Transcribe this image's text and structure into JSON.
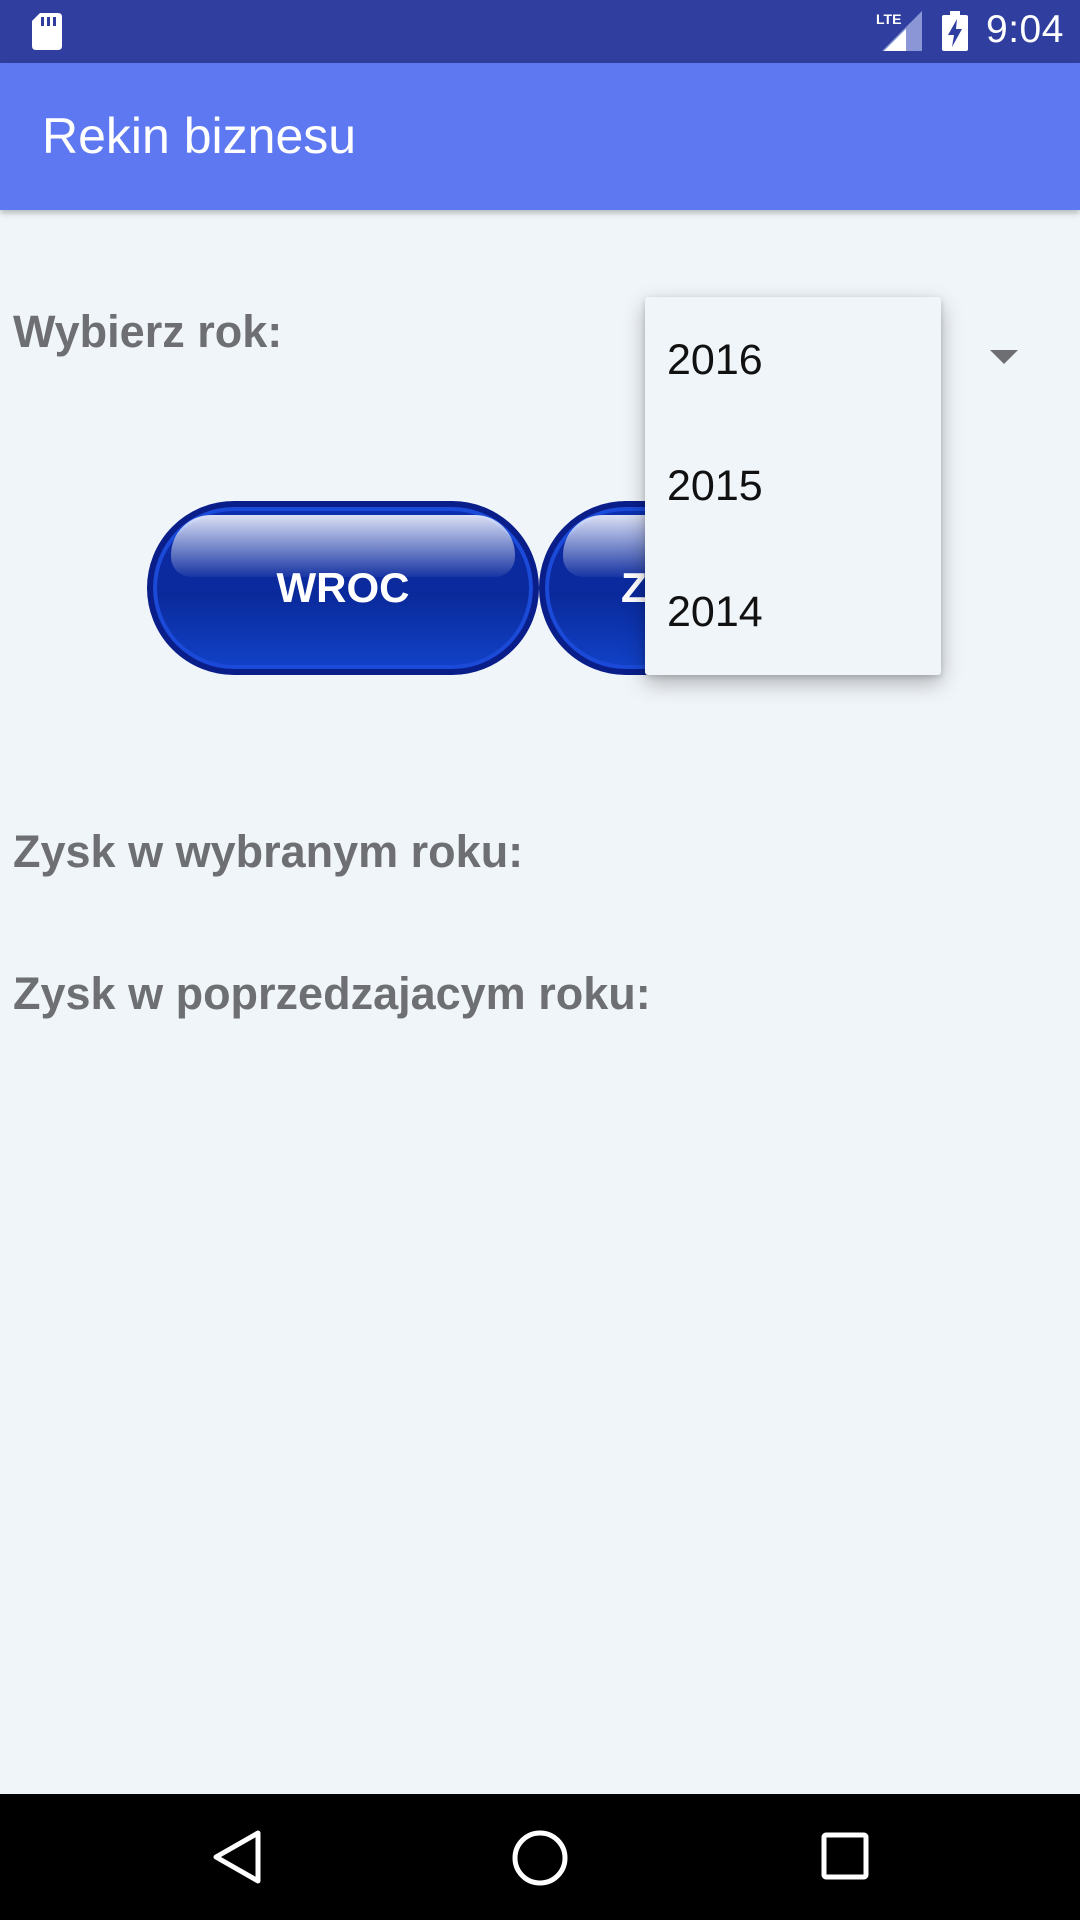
{
  "status_bar": {
    "time": "9:04",
    "network": "LTE",
    "icons": [
      "sd-card-icon",
      "lte-signal-icon",
      "battery-charging-icon"
    ]
  },
  "app_bar": {
    "title": "Rekin biznesu",
    "color": "#5e78f1"
  },
  "form": {
    "year_label": "Wybierz rok:",
    "profit_selected_label": "Zysk w wybranym roku:",
    "profit_previous_label": "Zysk w poprzedzajacym roku:"
  },
  "buttons": {
    "back_label": "WROC",
    "second_label": "Z"
  },
  "year_dropdown": {
    "options": [
      "2016",
      "2015",
      "2014"
    ]
  },
  "nav_bar": {
    "icons": [
      "back-icon",
      "home-icon",
      "recents-icon"
    ]
  },
  "colors": {
    "status_bar": "#303f9f",
    "background": "#f0f5f9",
    "label_text": "#6d6f72",
    "button_blue": "#0c2aa0"
  }
}
